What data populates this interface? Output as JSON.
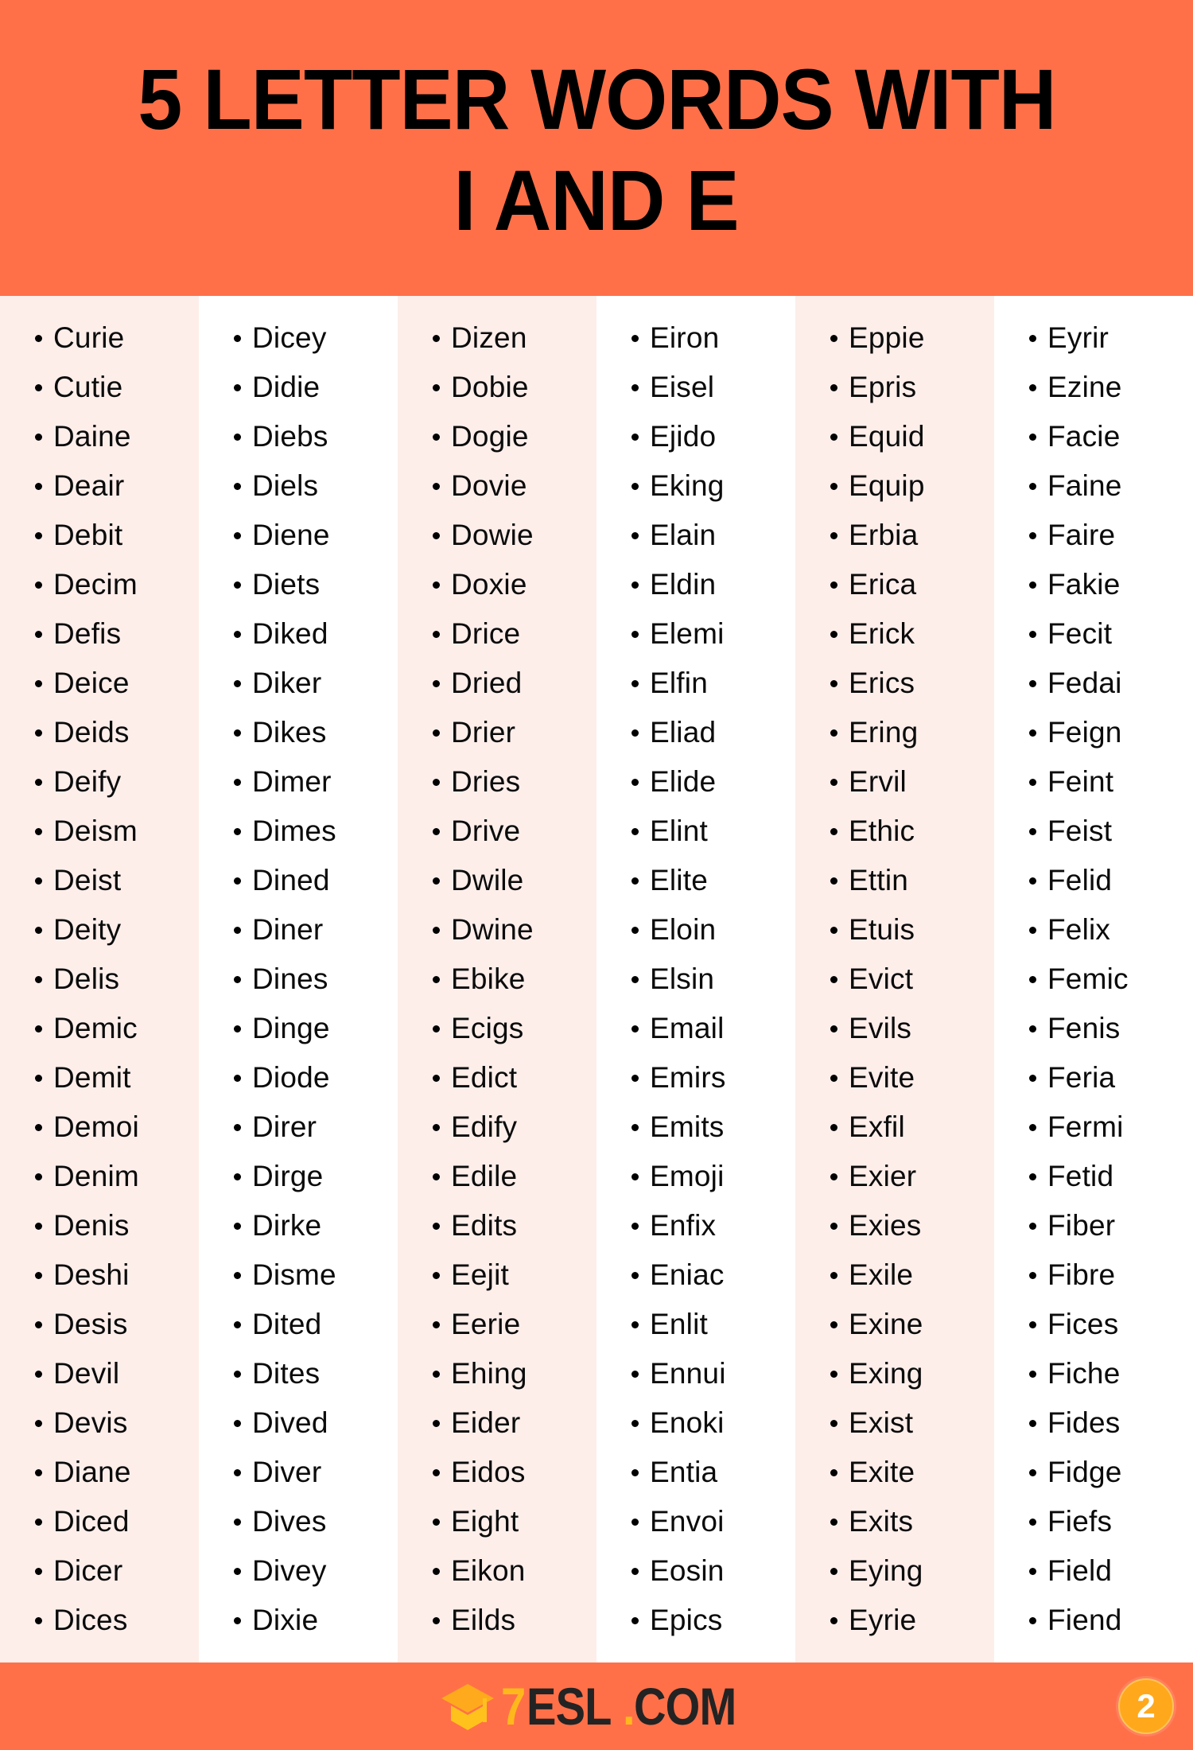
{
  "header": {
    "title_line1": "5 LETTER WORDS WITH",
    "title_line2": "I AND E",
    "background_color": "#FF7049",
    "text_color": "#000000"
  },
  "watermark": {
    "text": "7ESL.COM",
    "icon": "graduation-cap-icon"
  },
  "columns": [
    {
      "index": 1,
      "background": "#FDEEEA",
      "words": [
        "Curie",
        "Cutie",
        "Daine",
        "Deair",
        "Debit",
        "Decim",
        "Defis",
        "Deice",
        "Deids",
        "Deify",
        "Deism",
        "Deist",
        "Deity",
        "Delis",
        "Demic",
        "Demit",
        "Demoi",
        "Denim",
        "Denis",
        "Deshi",
        "Desis",
        "Devil",
        "Devis",
        "Diane",
        "Diced",
        "Dicer",
        "Dices"
      ]
    },
    {
      "index": 2,
      "background": "#FFFFFF",
      "words": [
        "Dicey",
        "Didie",
        "Diebs",
        "Diels",
        "Diene",
        "Diets",
        "Diked",
        "Diker",
        "Dikes",
        "Dimer",
        "Dimes",
        "Dined",
        "Diner",
        "Dines",
        "Dinge",
        "Diode",
        "Direr",
        "Dirge",
        "Dirke",
        "Disme",
        "Dited",
        "Dites",
        "Dived",
        "Diver",
        "Dives",
        "Divey",
        "Dixie"
      ]
    },
    {
      "index": 3,
      "background": "#FDEEEA",
      "words": [
        "Dizen",
        "Dobie",
        "Dogie",
        "Dovie",
        "Dowie",
        "Doxie",
        "Drice",
        "Dried",
        "Drier",
        "Dries",
        "Drive",
        "Dwile",
        "Dwine",
        "Ebike",
        "Ecigs",
        "Edict",
        "Edify",
        "Edile",
        "Edits",
        "Eejit",
        "Eerie",
        "Ehing",
        "Eider",
        "Eidos",
        "Eight",
        "Eikon",
        "Eilds"
      ]
    },
    {
      "index": 4,
      "background": "#FFFFFF",
      "words": [
        "Eiron",
        "Eisel",
        "Ejido",
        "Eking",
        "Elain",
        "Eldin",
        "Elemi",
        "Elfin",
        "Eliad",
        "Elide",
        "Elint",
        "Elite",
        "Eloin",
        "Elsin",
        "Email",
        "Emirs",
        "Emits",
        "Emoji",
        "Enfix",
        "Eniac",
        "Enlit",
        "Ennui",
        "Enoki",
        "Entia",
        "Envoi",
        "Eosin",
        "Epics"
      ]
    },
    {
      "index": 5,
      "background": "#FDEEEA",
      "words": [
        "Eppie",
        "Epris",
        "Equid",
        "Equip",
        "Erbia",
        "Erica",
        "Erick",
        "Erics",
        "Ering",
        "Ervil",
        "Ethic",
        "Ettin",
        "Etuis",
        "Evict",
        "Evils",
        "Evite",
        "Exfil",
        "Exier",
        "Exies",
        "Exile",
        "Exine",
        "Exing",
        "Exist",
        "Exite",
        "Exits",
        "Eying",
        "Eyrie"
      ]
    },
    {
      "index": 6,
      "background": "#FFFFFF",
      "words": [
        "Eyrir",
        "Ezine",
        "Facie",
        "Faine",
        "Faire",
        "Fakie",
        "Fecit",
        "Fedai",
        "Feign",
        "Feint",
        "Feist",
        "Felid",
        "Felix",
        "Femic",
        "Fenis",
        "Feria",
        "Fermi",
        "Fetid",
        "Fiber",
        "Fibre",
        "Fices",
        "Fiche",
        "Fides",
        "Fidge",
        "Fiefs",
        "Field",
        "Fiend"
      ]
    }
  ],
  "footer": {
    "background_color": "#FF7049",
    "logo_icon": "graduation-cap-icon",
    "logo_seven": "7",
    "logo_esl": "ESL",
    "logo_dot": ".",
    "logo_com": "COM",
    "page_number": "2",
    "page_badge_color": "#FFA81C"
  }
}
